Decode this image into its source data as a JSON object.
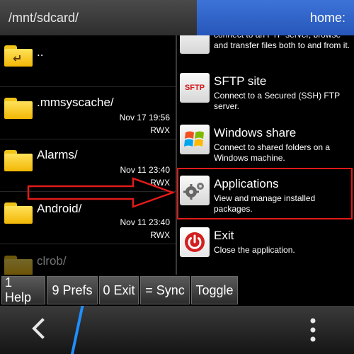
{
  "header": {
    "left_path": "/mnt/sdcard/",
    "right_path": "home:"
  },
  "left_panel": {
    "files": [
      {
        "name": "..",
        "date": "",
        "perm": "",
        "icon": "folder-up-icon"
      },
      {
        "name": ".mmsyscache/",
        "date": "Nov 17 19:56",
        "perm": "RWX",
        "icon": "folder-icon"
      },
      {
        "name": "Alarms/",
        "date": "Nov 11 23:40",
        "perm": "RWX",
        "icon": "folder-icon"
      },
      {
        "name": "Android/",
        "date": "Nov 11 23:40",
        "perm": "RWX",
        "icon": "folder-icon"
      },
      {
        "name": "clrob/",
        "date": "",
        "perm": "",
        "icon": "folder-icon"
      }
    ]
  },
  "right_panel": {
    "items": [
      {
        "title": "",
        "desc": "connect to an FTP server, browse and transfer files both to and from it.",
        "icon": "ftp-icon"
      },
      {
        "title": "SFTP site",
        "desc": "Connect to a Secured (SSH) FTP server.",
        "icon": "sftp-icon"
      },
      {
        "title": "Windows share",
        "desc": "Connect to shared folders on a Windows machine.",
        "icon": "windows-icon"
      },
      {
        "title": "Applications",
        "desc": "View and manage installed packages.",
        "icon": "gears-icon"
      },
      {
        "title": "Exit",
        "desc": "Close the application.",
        "icon": "power-icon"
      }
    ],
    "sftp_label": "SFTP"
  },
  "fkeys": {
    "help": "1 Help",
    "prefs": "9 Prefs",
    "exit": "0 Exit",
    "sync": "= Sync",
    "toggle": "Toggle"
  },
  "colors": {
    "header_blue": "#2f63c8",
    "highlight_red": "#e21a1a",
    "folder_yellow": "#f7c80f"
  }
}
